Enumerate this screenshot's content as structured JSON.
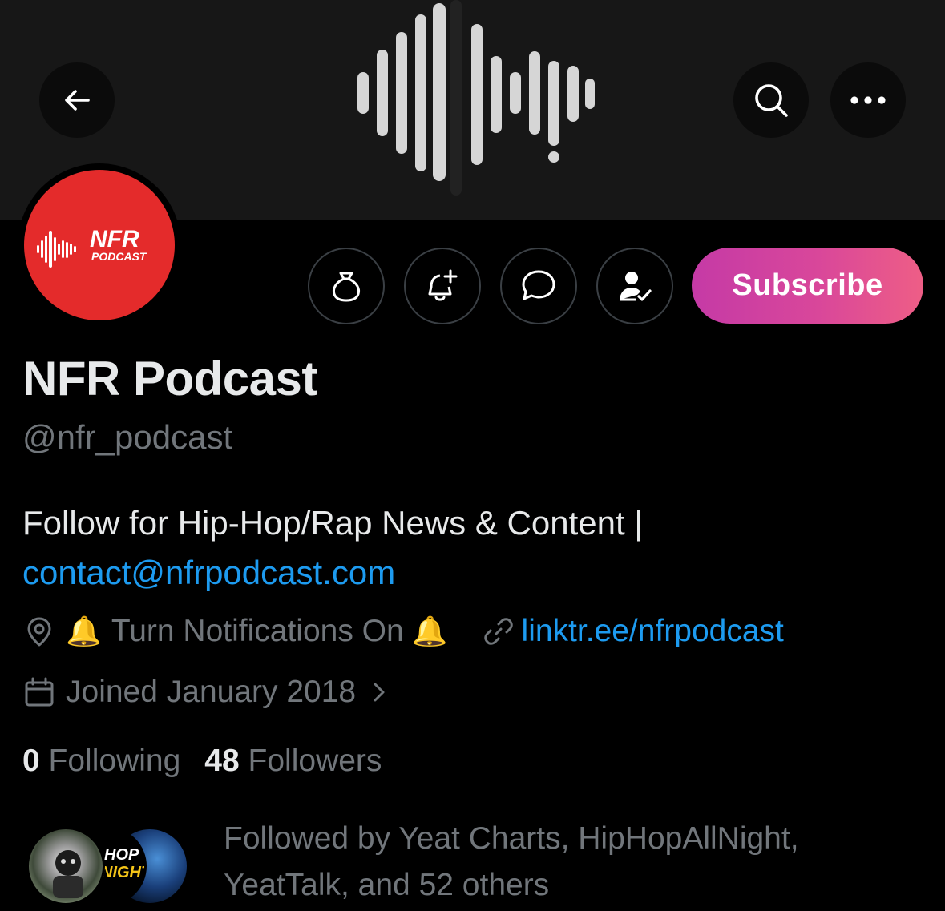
{
  "header": {
    "back_icon": "arrow-left-icon",
    "search_icon": "search-icon",
    "more_icon": "more-horizontal-icon"
  },
  "avatar": {
    "logo_text_main": "NFR",
    "logo_text_sub": "PODCAST",
    "background": "#e42b2b"
  },
  "actions": {
    "tip_icon": "money-bag-icon",
    "notify_icon": "bell-plus-icon",
    "message_icon": "chat-bubble-icon",
    "follow_icon": "person-check-icon",
    "subscribe_label": "Subscribe"
  },
  "profile": {
    "name": "NFR Podcast",
    "handle": "@nfr_podcast",
    "bio_text": "Follow for Hip-Hop/Rap News & Content |",
    "bio_link": "contact@nfrpodcast.com",
    "location_bell_left": "🔔",
    "location_text": "Turn Notifications On",
    "location_bell_right": "🔔",
    "website": "linktr.ee/nfrpodcast",
    "joined": "Joined January 2018",
    "following_count": "0",
    "following_label": "Following",
    "followers_count": "48",
    "followers_label": "Followers",
    "followed_by_line1": "Followed by Yeat Charts, HipHopAllNight,",
    "followed_by_line2": "YeatTalk, and 52 others",
    "follower_avatar_2_text_top": "HOP",
    "follower_avatar_2_text_bottom": "NIGHT"
  },
  "colors": {
    "link": "#1d9bf0",
    "muted": "#71767b",
    "text": "#e7e9ea",
    "subscribe_gradient_start": "#c53aa6",
    "subscribe_gradient_end": "#ee5e86"
  }
}
